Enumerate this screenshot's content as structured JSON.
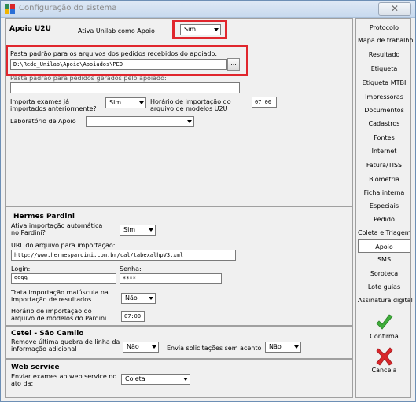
{
  "window": {
    "title": "Configuração do sistema",
    "close_glyph": "✕"
  },
  "u2u": {
    "title": "Apoio U2U",
    "ativa_label": "Ativa Unilab como Apoio",
    "ativa_value": "Sim",
    "pasta_label": "Pasta padrão para os arquivos dos pedidos recebidos do apoiado:",
    "pasta_value": "D:\\Rede_Unilab\\Apoio\\Apoiados\\PED",
    "browse_label": "...",
    "pasta2_label": "Pasta padrão para pedidos gerados pelo apoiado:",
    "pasta2_value": "",
    "importa_label": "Importa exames já importados anteriormente?",
    "importa_value": "Sim",
    "horario_label": "Horário de importação do arquivo de modelos U2U",
    "horario_value": "07:00",
    "lab_label": "Laboratório de Apoio",
    "lab_value": ""
  },
  "hermes": {
    "title": "Hermes Pardini",
    "ativa_label": "Ativa importação automática no Pardini?",
    "ativa_value": "Sim",
    "url_label": "URL do arquivo para importação:",
    "url_value": "http://www.hermespardini.com.br/cal/tabexalhpV3.xml",
    "login_label": "Login:",
    "login_value": "9999",
    "senha_label": "Senha:",
    "senha_value": "****",
    "trata_label": "Trata importação maiúscula na importação de resultados",
    "trata_value": "Não",
    "horario_label": "Horário de importação do arquivo de modelos do Pardini",
    "horario_value": "07:00"
  },
  "cetel": {
    "title": "Cetel - São Camilo",
    "remove_label": "Remove última quebra de linha da informação adicional",
    "remove_value": "Não",
    "envia_label": "Envia solicitações sem acento",
    "envia_value": "Não"
  },
  "webservice": {
    "title": "Web service",
    "enviar_label": "Enviar exames ao web service no ato da:",
    "enviar_value": "Coleta"
  },
  "sidebar": {
    "items": [
      "Protocolo",
      "Mapa de trabalho",
      "Resultado",
      "Etiqueta",
      "Etiqueta MTBI",
      "Impressoras",
      "Documentos",
      "Cadastros",
      "Fontes",
      "Internet",
      "Fatura/TISS",
      "Biometria",
      "Ficha interna",
      "Especiais",
      "Pedido",
      "Coleta e Triagem",
      "Apoio",
      "SMS",
      "Soroteca",
      "Lote guias",
      "Assinatura digital"
    ],
    "active": "Apoio",
    "confirm_label": "Confirma",
    "cancel_label": "Cancela"
  },
  "colors": {
    "highlight": "#e0262d",
    "confirm": "#3fae3a",
    "cancel": "#d9262a"
  },
  "icons": {
    "confirm": "checkmark-icon",
    "cancel": "x-icon"
  }
}
